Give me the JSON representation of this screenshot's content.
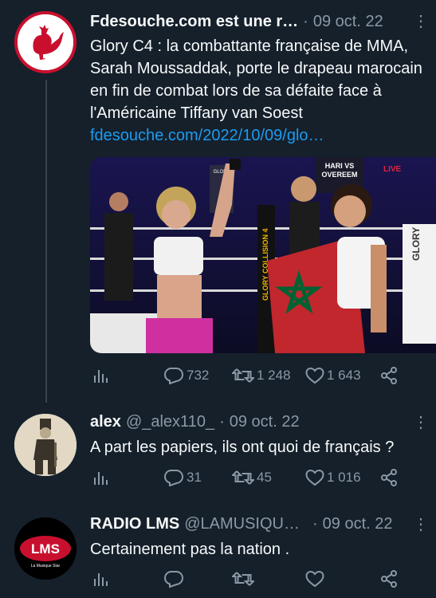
{
  "tweets": [
    {
      "name": "Fdesouche.com est une r…",
      "handle": "",
      "date": "09 oct. 22",
      "text": "Glory C4 : la combattante française de MMA, Sarah Moussaddak, porte le  drapeau marocain en fin de combat lors de sa défaite face à l'Américaine Tiffany van Soest ",
      "link": "fdesouche.com/2022/10/09/glo…",
      "stats": {
        "replies": "732",
        "retweets": "1 248",
        "likes": "1 643"
      },
      "media": {
        "banner1": "HARI VS OVEREEM",
        "banner2": "GLORY COLLISION 4",
        "ring": "GLORY",
        "shirt": "GLORY",
        "live": "LIVE"
      }
    },
    {
      "name": "alex",
      "handle": "@_alex110_",
      "date": "09 oct. 22",
      "text": "A part les papiers, ils ont quoi de français ?",
      "stats": {
        "replies": "31",
        "retweets": "45",
        "likes": "1 016"
      }
    },
    {
      "name": "RADIO LMS",
      "handle": "@LAMUSIQU…",
      "date": "09 oct. 22",
      "text": "Certainement pas la nation .",
      "avatar_text": "LMS",
      "avatar_sub": "La Musique Star",
      "stats": {
        "replies": "",
        "retweets": "",
        "likes": ""
      }
    }
  ],
  "icons": {
    "more": "more-icon",
    "views": "views-icon",
    "reply": "reply-icon",
    "retweet": "retweet-icon",
    "like": "like-icon",
    "share": "share-icon"
  },
  "colors": {
    "background": "#15202b",
    "text": "#f7f9f9",
    "muted": "#8b98a5",
    "link": "#1d9bf0"
  }
}
